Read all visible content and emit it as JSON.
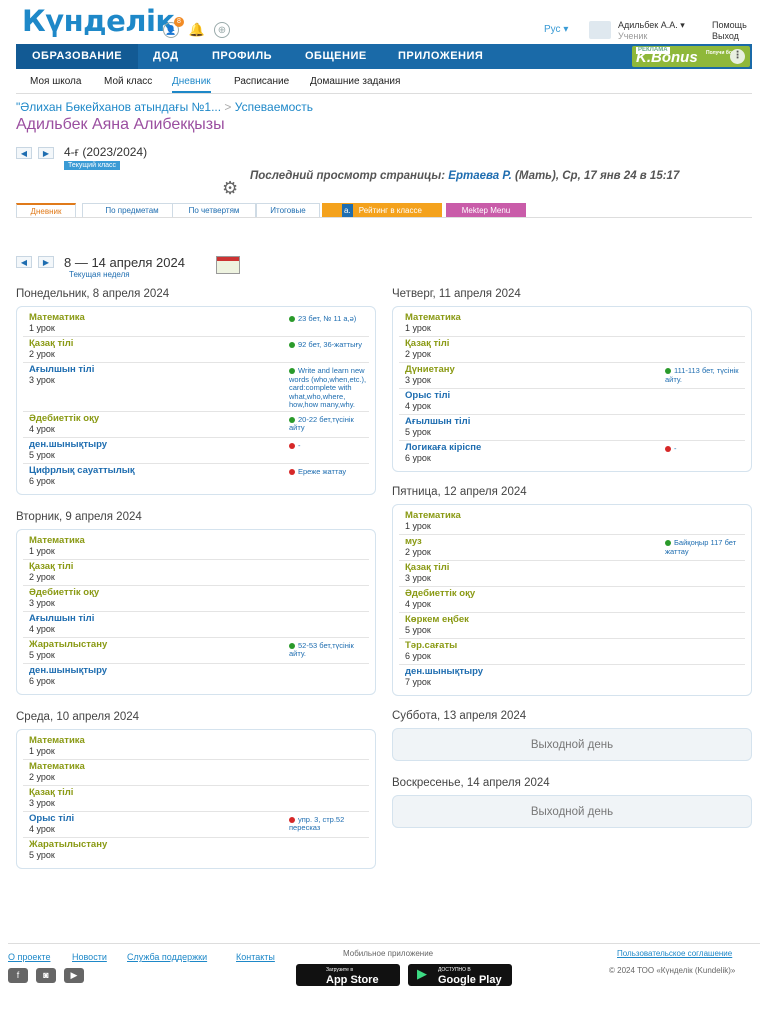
{
  "header": {
    "logo": "Күнделік",
    "notif_count": "8",
    "lang": "Рус",
    "user_name": "Адильбек А.А.",
    "user_role": "Ученик",
    "help": "Помощь",
    "logout": "Выход"
  },
  "nav": [
    "ОБРАЗОВАНИЕ",
    "ДОД",
    "ПРОФИЛЬ",
    "ОБЩЕНИЕ",
    "ПРИЛОЖЕНИЯ"
  ],
  "bonus": {
    "ad": "РЕКЛАМА",
    "title": "K.Bonus",
    "sub": "Получи бон..."
  },
  "subnav": [
    "Моя школа",
    "Мой класс",
    "Дневник",
    "Расписание",
    "Домашние задания"
  ],
  "breadcrumb": {
    "school": "\"Әлихан Бөкейханов атындағы №1...",
    "section": "Успеваемость"
  },
  "person": "Адильбек Аяна Алибекқызы",
  "grade": "4-ғ (2023/2024)",
  "current_class": "Текущий класс",
  "last_view": {
    "prefix": "Последний просмотр страницы:",
    "name": "Ертаева Р.",
    "suffix": "(Мать), Ср, 17 янв 24 в 15:17"
  },
  "tabs": [
    "Дневник",
    "По предметам",
    "По четвертям",
    "Итоговые",
    "Рейтинг в классе",
    "Mektep Menu"
  ],
  "tab_logo": "a.",
  "week": {
    "range": "8 — 14 апреля 2024",
    "label": "Текущая неделя"
  },
  "days": {
    "mon": {
      "title": "Понедельник, 8 апреля 2024",
      "lessons": [
        {
          "subject": "Математика",
          "num": "1 урок",
          "hw": "23 бет, № 11 а,ә)"
        },
        {
          "subject": "Қазақ тілі",
          "num": "2 урок",
          "hw": "92 бет, 36-жаттығу"
        },
        {
          "subject": "Ағылшын тілі",
          "num": "3 урок",
          "hw": "Write and learn new words (who,when,etc.), card:complete with what,who,where, how,how many,why."
        },
        {
          "subject": "Әдебиеттік оқу",
          "num": "4 урок",
          "hw": "20-22 бет,түсінік айту"
        },
        {
          "subject": "ден.шынықтыру",
          "num": "5 урок",
          "hw": "-"
        },
        {
          "subject": "Цифрлық сауаттылық",
          "num": "6 урок",
          "hw": "Ереже жаттау"
        }
      ]
    },
    "tue": {
      "title": "Вторник, 9 апреля 2024",
      "lessons": [
        {
          "subject": "Математика",
          "num": "1 урок",
          "hw": ""
        },
        {
          "subject": "Қазақ тілі",
          "num": "2 урок",
          "hw": ""
        },
        {
          "subject": "Әдебиеттік оқу",
          "num": "3 урок",
          "hw": ""
        },
        {
          "subject": "Ағылшын тілі",
          "num": "4 урок",
          "hw": ""
        },
        {
          "subject": "Жаратылыстану",
          "num": "5 урок",
          "hw": "52-53 бет,түсінік айту."
        },
        {
          "subject": "ден.шынықтыру",
          "num": "6 урок",
          "hw": ""
        }
      ]
    },
    "wed": {
      "title": "Среда, 10 апреля 2024",
      "lessons": [
        {
          "subject": "Математика",
          "num": "1 урок",
          "hw": ""
        },
        {
          "subject": "Математика",
          "num": "2 урок",
          "hw": ""
        },
        {
          "subject": "Қазақ тілі",
          "num": "3 урок",
          "hw": ""
        },
        {
          "subject": "Орыс тілі",
          "num": "4 урок",
          "hw": "упр. 3, стр.52 пересказ"
        },
        {
          "subject": "Жаратылыстану",
          "num": "5 урок",
          "hw": ""
        }
      ]
    },
    "thu": {
      "title": "Четверг, 11 апреля 2024",
      "lessons": [
        {
          "subject": "Математика",
          "num": "1 урок",
          "hw": ""
        },
        {
          "subject": "Қазақ тілі",
          "num": "2 урок",
          "hw": ""
        },
        {
          "subject": "Дүниетану",
          "num": "3 урок",
          "hw": "111-113 бет, түсінік айту."
        },
        {
          "subject": "Орыс тілі",
          "num": "4 урок",
          "hw": ""
        },
        {
          "subject": "Ағылшын тілі",
          "num": "5 урок",
          "hw": ""
        },
        {
          "subject": "Логикаға кіріспе",
          "num": "6 урок",
          "hw": "-"
        }
      ]
    },
    "fri": {
      "title": "Пятница, 12 апреля 2024",
      "lessons": [
        {
          "subject": "Математика",
          "num": "1 урок",
          "hw": ""
        },
        {
          "subject": "муз",
          "num": "2 урок",
          "hw": "Байқоңыр 117 бет жаттау"
        },
        {
          "subject": "Қазақ тілі",
          "num": "3 урок",
          "hw": ""
        },
        {
          "subject": "Әдебиеттік оқу",
          "num": "4 урок",
          "hw": ""
        },
        {
          "subject": "Көркем еңбек",
          "num": "5 урок",
          "hw": ""
        },
        {
          "subject": "Тәр.сағаты",
          "num": "6 урок",
          "hw": ""
        },
        {
          "subject": "ден.шынықтыру",
          "num": "7 урок",
          "hw": ""
        }
      ]
    },
    "sat": {
      "title": "Суббота, 13 апреля 2024",
      "off": "Выходной день"
    },
    "sun": {
      "title": "Воскресенье, 14 апреля 2024",
      "off": "Выходной день"
    }
  },
  "footer": {
    "links": [
      "О проекте",
      "Новости",
      "Служба поддержки",
      "Контакты"
    ],
    "mobile": "Мобильное приложение",
    "appstore_small": "Загрузите в",
    "appstore": "App Store",
    "gplay_small": "ДОСТУПНО В",
    "gplay": "Google Play",
    "terms": "Пользовательское соглашение",
    "copyright": "© 2024 ТОО «Күнделік (Kundelik)»"
  }
}
